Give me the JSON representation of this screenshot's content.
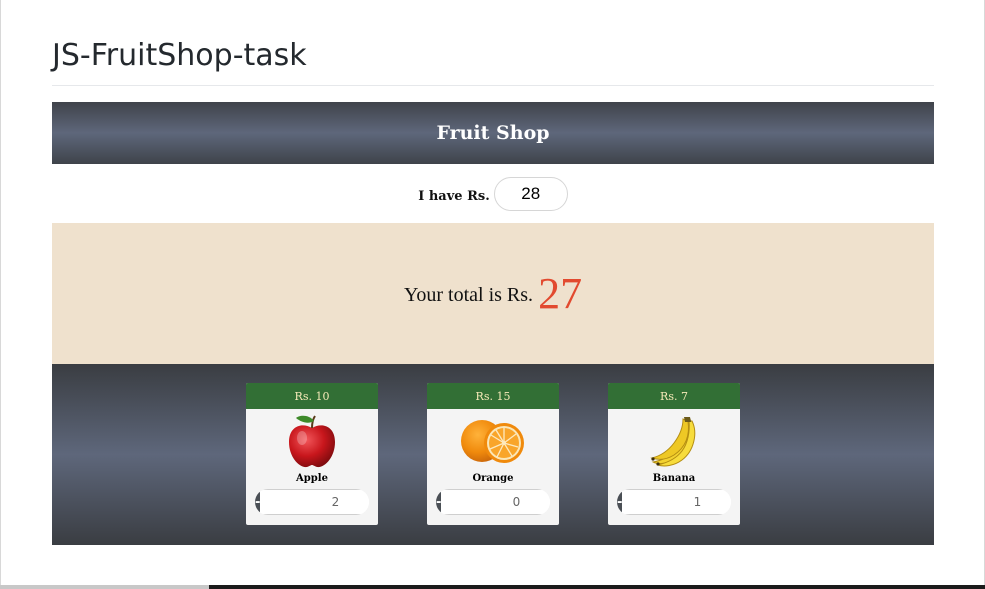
{
  "page": {
    "title": "JS-FruitShop-task"
  },
  "shop": {
    "header": "Fruit Shop"
  },
  "budget": {
    "label": "I have Rs.",
    "value": "28"
  },
  "total": {
    "label": "Your total is Rs.",
    "value": "27"
  },
  "products": [
    {
      "price": "Rs. 10",
      "name": "Apple",
      "icon": "apple-icon",
      "quantity": "2",
      "minus": "-",
      "plus": "+"
    },
    {
      "price": "Rs. 15",
      "name": "Orange",
      "icon": "orange-icon",
      "quantity": "0",
      "minus": "-",
      "plus": "+"
    },
    {
      "price": "Rs. 7",
      "name": "Banana",
      "icon": "banana-icon",
      "quantity": "1",
      "minus": "-",
      "plus": "+"
    }
  ],
  "colors": {
    "price_bar": "#326f35",
    "price_text": "#f5e9b8",
    "total_value": "#e24a2f",
    "total_panel": "#efe1cd",
    "header_mid": "#5e677b"
  }
}
